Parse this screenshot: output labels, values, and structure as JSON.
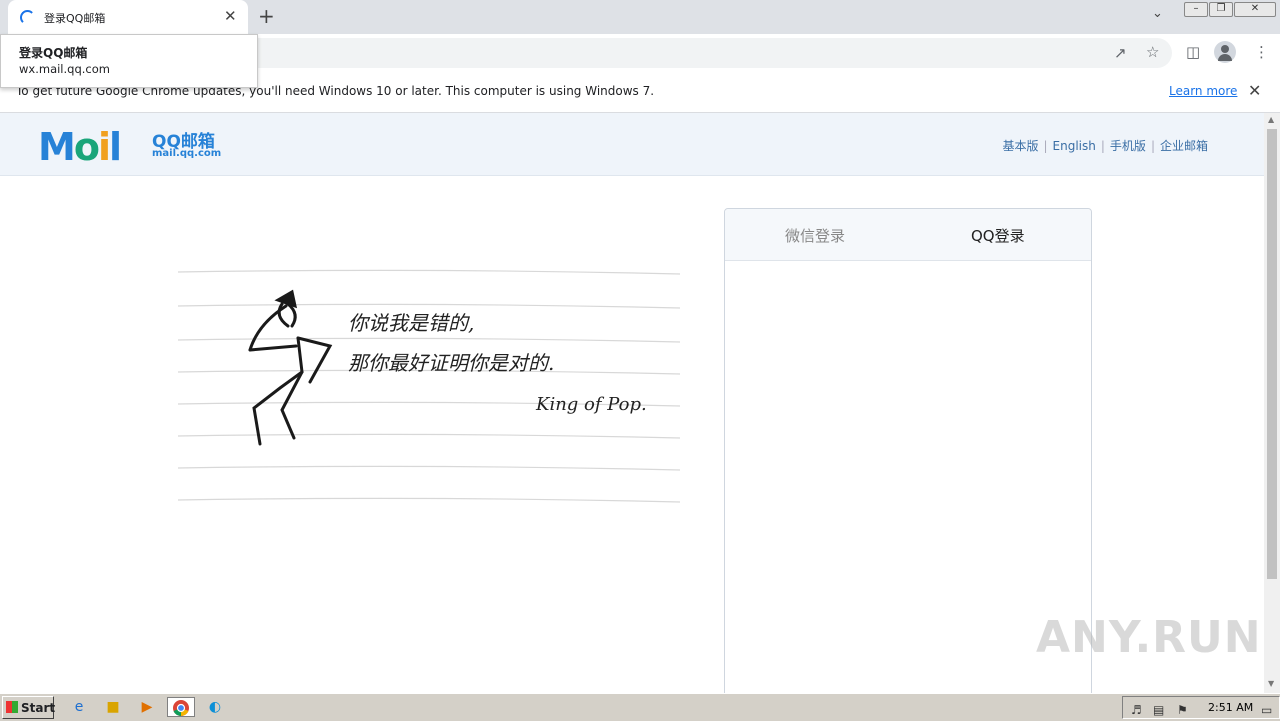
{
  "browser": {
    "tab_title": "登录QQ邮箱",
    "tooltip_title": "登录QQ邮箱",
    "tooltip_url": "wx.mail.qq.com",
    "new_tab_symbol": "+",
    "tab_close_symbol": "✕"
  },
  "infobar": {
    "message": "To get future Google Chrome updates, you'll need Windows 10 or later. This computer is using Windows 7.",
    "learn_more": "Learn more"
  },
  "header": {
    "logo_text": "QQ邮箱",
    "logo_domain": "mail.qq.com",
    "links": [
      "基本版",
      "English",
      "手机版",
      "企业邮箱"
    ]
  },
  "illustration": {
    "line1": "你说我是错的,",
    "line2": "那你最好证明你是对的.",
    "signature": "King of Pop."
  },
  "login": {
    "tab_wechat": "微信登录",
    "tab_qq": "QQ登录"
  },
  "watermark": "ANY.RUN",
  "taskbar": {
    "start": "Start",
    "clock": "2:51 AM"
  },
  "colors": {
    "brand_blue": "#2782d7",
    "header_bg": "#eff4fa",
    "link_blue": "#1a73e8"
  }
}
